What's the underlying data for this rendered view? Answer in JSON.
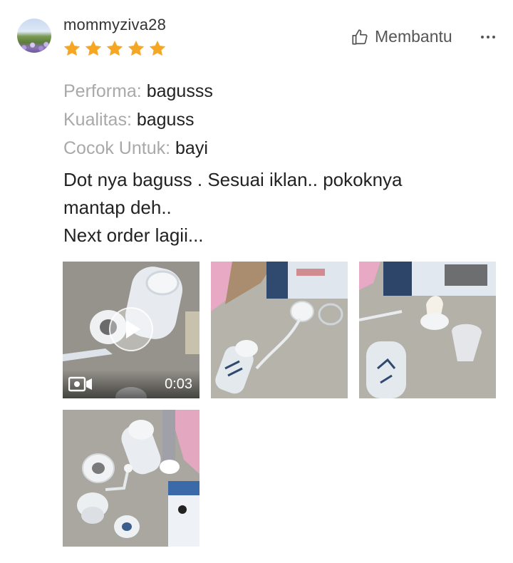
{
  "review": {
    "username": "mommyziva28",
    "rating": 5,
    "helpful_label": "Membantu",
    "attributes": [
      {
        "key": "Performa:",
        "value": "bagusss"
      },
      {
        "key": "Kualitas:",
        "value": "baguss"
      },
      {
        "key": "Cocok Untuk:",
        "value": "bayi"
      }
    ],
    "text_lines": [
      "Dot nya baguss . Sesuai iklan.. pokoknya",
      "mantap deh..",
      "Next order lagii..."
    ]
  },
  "media": {
    "video_duration": "0:03",
    "items": [
      {
        "type": "video"
      },
      {
        "type": "photo"
      },
      {
        "type": "photo"
      },
      {
        "type": "photo"
      }
    ]
  },
  "colors": {
    "star": "#f5a623",
    "label_gray": "#a9a9a9",
    "text": "#222222"
  },
  "icons": {
    "avatar": "avatar",
    "star": "star-icon",
    "helpful": "thumbs-up-icon",
    "more": "more-icon",
    "play": "play-icon",
    "video": "video-camera-icon"
  }
}
